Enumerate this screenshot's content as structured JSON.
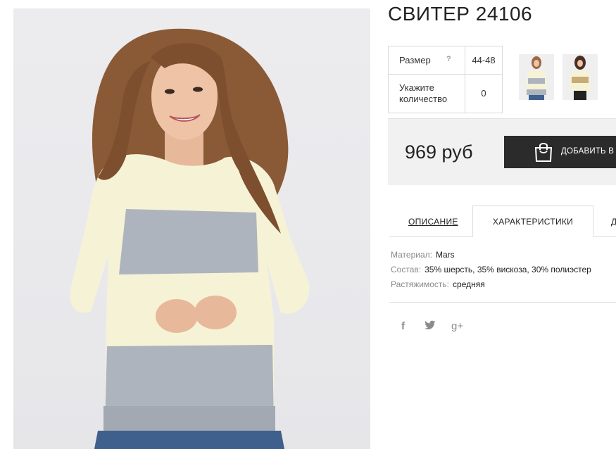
{
  "product": {
    "title": "СВИТЕР 24106"
  },
  "options": {
    "size_label": "Размер",
    "size_help": "?",
    "size_value": "44-48",
    "qty_label": "Укажите количество",
    "qty_value": "0"
  },
  "price": {
    "amount": "969 руб",
    "add_to_cart_label": "ДОБАВИТЬ В"
  },
  "tabs": [
    {
      "label": "ОПИСАНИЕ"
    },
    {
      "label": "ХАРАКТЕРИСТИКИ"
    },
    {
      "label": "Д"
    }
  ],
  "specs": [
    {
      "key": "Материал:",
      "value": "Mars"
    },
    {
      "key": "Состав:",
      "value": "35% шерсть, 35% вискоза, 30% полиэстер"
    },
    {
      "key": "Растяжимость:",
      "value": "средняя"
    }
  ],
  "social": {
    "facebook": "f",
    "twitter": "🐦",
    "gplus": "g+"
  },
  "colors": {
    "cream": "#f6f2d6",
    "grey_stripe": "#aeb4bd",
    "button": "#2b2b2b",
    "panel": "#f1f1f1"
  }
}
